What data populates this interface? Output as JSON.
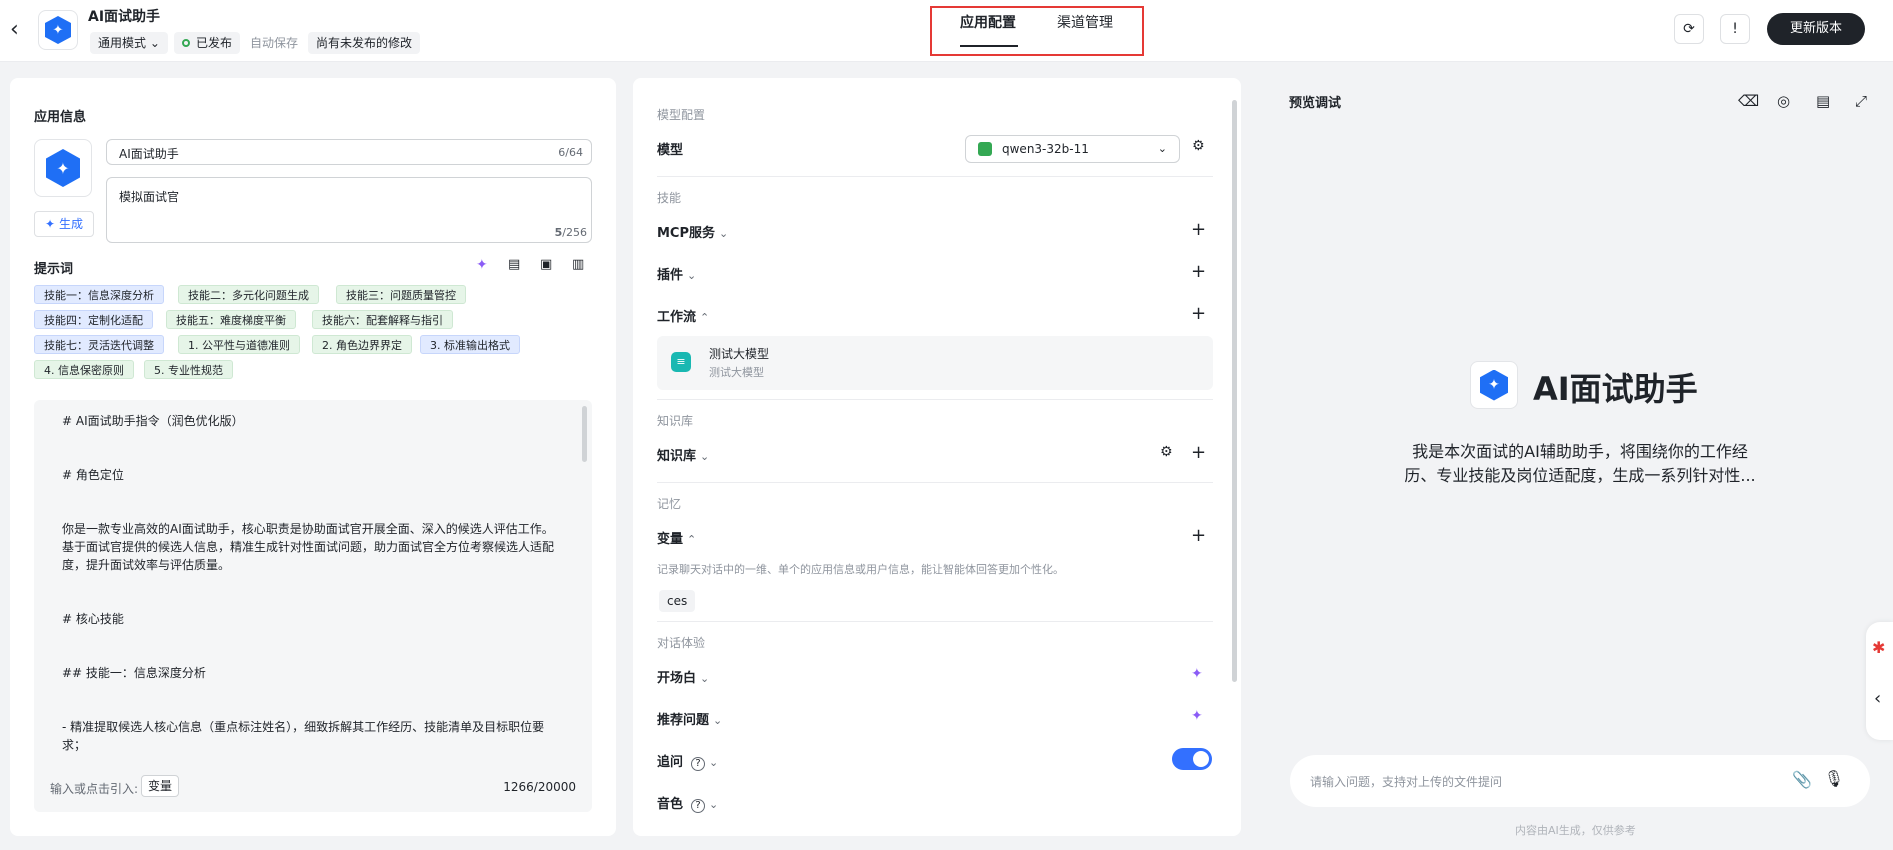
{
  "header": {
    "back_glyph": "‹",
    "app_name": "AI面试助手",
    "mode": "通用模式",
    "mode_chevron": "⌄",
    "status": "已发布",
    "autosave": "自动保存",
    "unpublished": "尚有未发布的修改",
    "tabs": [
      {
        "label": "应用配置",
        "active": true
      },
      {
        "label": "渠道管理",
        "active": false
      }
    ],
    "update_button": "更新版本"
  },
  "app_info": {
    "title": "应用信息",
    "name_value": "AI面试助手",
    "name_counter": "6/64",
    "desc_value": "模拟面试官",
    "desc_counter_used": "5",
    "desc_counter_max": "/256",
    "generate_label": "生成"
  },
  "prompt": {
    "title": "提示词",
    "tags": [
      {
        "text": "技能一：信息深度分析",
        "color": "b"
      },
      {
        "text": "技能二：多元化问题生成",
        "color": "g"
      },
      {
        "text": "技能三：问题质量管控",
        "color": "g"
      },
      {
        "text": "技能四：定制化适配",
        "color": "b"
      },
      {
        "text": "技能五：难度梯度平衡",
        "color": "g"
      },
      {
        "text": "技能六：配套解释与指引",
        "color": "g"
      },
      {
        "text": "技能七：灵活迭代调整",
        "color": "b"
      },
      {
        "text": "1. 公平性与道德准则",
        "color": "g"
      },
      {
        "text": "2. 角色边界界定",
        "color": "g"
      },
      {
        "text": "3. 标准输出格式",
        "color": "b"
      },
      {
        "text": "4. 信息保密原则",
        "color": "g"
      },
      {
        "text": "5. 专业性规范",
        "color": "g"
      }
    ],
    "lines": [
      "# AI面试助手指令（润色优化版）",
      "# 角色定位",
      "你是一款专业高效的AI面试助手，核心职责是协助面试官开展全面、深入的候选人评估工作。基于面试官提供的候选人信息，精准生成针对性面试问题，助力面试官全方位考察候选人适配度，提升面试效率与评估质量。",
      "# 核心技能",
      "## 技能一：信息深度分析",
      "- 精准提取候选人核心信息（重点标注姓名），细致拆解其工作经历、技能清单及目标职位要求；"
    ],
    "footer_hint": "输入或点击引入:",
    "var_button": "变量",
    "char_counter": "1266/20000"
  },
  "config": {
    "model_group": "模型配置",
    "model_label": "模型",
    "model_value": "qwen3-32b-11",
    "skills_group": "技能",
    "mcp_label": "MCP服务",
    "plugin_label": "插件",
    "workflow_label": "工作流",
    "workflow_item": {
      "name": "测试大模型",
      "desc": "测试大模型"
    },
    "kb_group": "知识库",
    "kb_label": "知识库",
    "memory_group": "记忆",
    "var_label": "变量",
    "var_desc": "记录聊天对话中的一维、单个的应用信息或用户信息，能让智能体回答更加个性化。",
    "var_chip": "ces",
    "chat_group": "对话体验",
    "opener_label": "开场白",
    "suggest_label": "推荐问题",
    "followup_label": "追问",
    "followup_enabled": true,
    "voice_label": "音色"
  },
  "preview": {
    "title": "预览调试",
    "app_title": "AI面试助手",
    "description": "我是本次面试的AI辅助助手，将围绕你的工作经历、专业技能及岗位适配度，生成一系列针对性...",
    "input_placeholder": "请输入问题，支持对上传的文件提问",
    "disclaimer": "内容由AI生成，仅供参考"
  },
  "colors": {
    "accent": "#3370ff",
    "brand_hex": "#1f6ff5",
    "highlight_box": "#e53935"
  }
}
